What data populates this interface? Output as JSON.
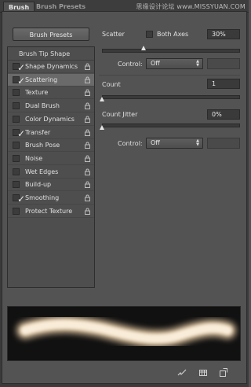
{
  "tabs": [
    {
      "label": "Brush",
      "active": true
    },
    {
      "label": "Brush Presets",
      "active": false
    }
  ],
  "watermark": "思缘设计论坛 www.MISSYUAN.COM",
  "left": {
    "presets_button": "Brush Presets",
    "header": "Brush Tip Shape",
    "items": [
      {
        "label": "Shape Dynamics",
        "checked": true,
        "selected": false
      },
      {
        "label": "Scattering",
        "checked": true,
        "selected": true
      },
      {
        "label": "Texture",
        "checked": false,
        "selected": false
      },
      {
        "label": "Dual Brush",
        "checked": false,
        "selected": false
      },
      {
        "label": "Color Dynamics",
        "checked": false,
        "selected": false
      },
      {
        "label": "Transfer",
        "checked": true,
        "selected": false
      },
      {
        "label": "Brush Pose",
        "checked": false,
        "selected": false
      },
      {
        "label": "Noise",
        "checked": false,
        "selected": false
      },
      {
        "label": "Wet Edges",
        "checked": false,
        "selected": false
      },
      {
        "label": "Build-up",
        "checked": false,
        "selected": false
      },
      {
        "label": "Smoothing",
        "checked": true,
        "selected": false
      },
      {
        "label": "Protect Texture",
        "checked": false,
        "selected": false
      }
    ]
  },
  "right": {
    "scatter": {
      "label": "Scatter",
      "both_axes_label": "Both Axes",
      "both_axes_checked": false,
      "value": "30%",
      "slider": 0.3
    },
    "control1": {
      "label": "Control:",
      "value": "Off"
    },
    "count": {
      "label": "Count",
      "value": "1",
      "slider": 0.0
    },
    "count_jitter": {
      "label": "Count Jitter",
      "value": "0%",
      "slider": 0.0
    },
    "control2": {
      "label": "Control:",
      "value": "Off"
    }
  },
  "colors": {
    "panel": "#535353",
    "selected_row": "#6a6a6a",
    "stroke": "#f3dfc0"
  },
  "icons": [
    "lock-icon",
    "brush-toggle-icon",
    "grid-icon",
    "new-preset-icon"
  ]
}
